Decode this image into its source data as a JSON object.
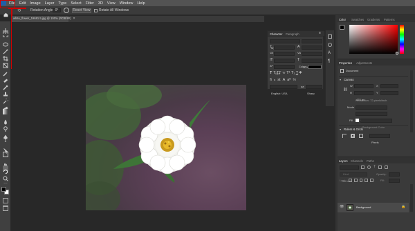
{
  "menu": {
    "items": [
      "File",
      "Edit",
      "Image",
      "Layer",
      "Type",
      "Select",
      "Filter",
      "3D",
      "View",
      "Window",
      "Help"
    ]
  },
  "options": {
    "rotation_label": "Rotation Angle:",
    "rotation_value": "0°",
    "reset_view": "Reset View",
    "rotate_all": "Rotate All Windows"
  },
  "document": {
    "tab_title": "white_flower_19681 5.jpg @ 100% (RGB/8#)"
  },
  "character": {
    "tabs": [
      "Character",
      "Paragraph"
    ],
    "font_family": "Myriad Pro",
    "font_style": "Regular",
    "size": "12 pt",
    "leading": "(Auto)",
    "kerning": "Metrics",
    "tracking": "0",
    "vscale": "100%",
    "hscale": "100%",
    "baseline": "0 pt",
    "color_label": "Color:",
    "language": "English: USA",
    "aa_label": "aa",
    "aa": "Sharp"
  },
  "color_panel": {
    "tabs": [
      "Color",
      "Swatches",
      "Gradients",
      "Patterns"
    ]
  },
  "properties": {
    "tabs": [
      "Properties",
      "Adjustments"
    ],
    "doc_label": "Document",
    "canvas_title": "Canvas",
    "w_label": "W",
    "w_value": "600 px",
    "h_label": "H",
    "h_value": "470 px",
    "x_label": "X",
    "y_label": "Y",
    "resolution": "Resolution: 72 pixels/inch",
    "mode_label": "Mode",
    "mode_value": "RGB Color",
    "depth_value": "8 Bits/Channel",
    "fill_label": "Fill",
    "fill_value": "Background Color",
    "rulers_title": "Rulers & Grids",
    "units": "Pixels"
  },
  "layers": {
    "tabs": [
      "Layers",
      "Channels",
      "Paths"
    ],
    "filter_label": "Kind",
    "blend": "Normal",
    "opacity_label": "Opacity:",
    "lock_label": "Lock:",
    "fill_label": "Fill:",
    "layer_name": "Background"
  },
  "colors": {
    "highlight": "#d30000",
    "menubar": "#535353",
    "panel": "#3a3a3a",
    "canvas_bg": "#282828"
  }
}
